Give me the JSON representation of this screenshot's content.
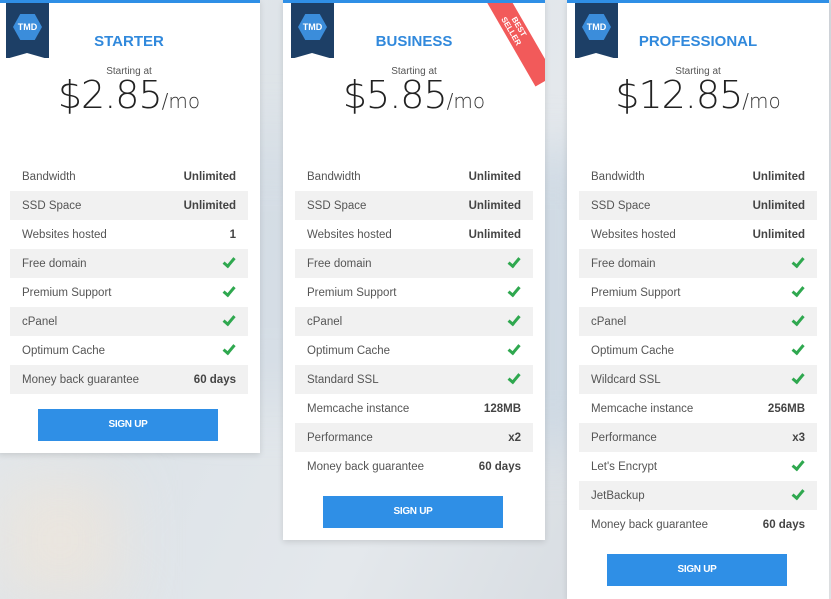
{
  "logo_text": "TMD",
  "starting_label": "Starting at",
  "per_label": "/mo",
  "signup_label": "SIGN UP",
  "best_seller": [
    "BEST",
    "SELLER"
  ],
  "colors": {
    "accent": "#2f8fe6",
    "ribbon": "#1d3f66",
    "badge": "#f25a5a",
    "check": "#2fa84f"
  },
  "plans": [
    {
      "name": "STARTER",
      "price": "$2.85",
      "features": [
        {
          "label": "Bandwidth",
          "value": "Unlimited"
        },
        {
          "label": "SSD Space",
          "value": "Unlimited"
        },
        {
          "label": "Websites hosted",
          "value": "1"
        },
        {
          "label": "Free domain",
          "value": "check"
        },
        {
          "label": "Premium Support",
          "value": "check"
        },
        {
          "label": "cPanel",
          "value": "check"
        },
        {
          "label": "Optimum Cache",
          "value": "check"
        },
        {
          "label": "Money back guarantee",
          "value": "60 days"
        }
      ]
    },
    {
      "name": "BUSINESS",
      "price": "$5.85",
      "features": [
        {
          "label": "Bandwidth",
          "value": "Unlimited"
        },
        {
          "label": "SSD Space",
          "value": "Unlimited"
        },
        {
          "label": "Websites hosted",
          "value": "Unlimited"
        },
        {
          "label": "Free domain",
          "value": "check"
        },
        {
          "label": "Premium Support",
          "value": "check"
        },
        {
          "label": "cPanel",
          "value": "check"
        },
        {
          "label": "Optimum Cache",
          "value": "check"
        },
        {
          "label": "Standard SSL",
          "value": "check"
        },
        {
          "label": "Memcache instance",
          "value": "128MB"
        },
        {
          "label": "Performance",
          "value": "x2"
        },
        {
          "label": "Money back guarantee",
          "value": "60 days"
        }
      ]
    },
    {
      "name": "PROFESSIONAL",
      "price": "$12.85",
      "features": [
        {
          "label": "Bandwidth",
          "value": "Unlimited"
        },
        {
          "label": "SSD Space",
          "value": "Unlimited"
        },
        {
          "label": "Websites hosted",
          "value": "Unlimited"
        },
        {
          "label": "Free domain",
          "value": "check"
        },
        {
          "label": "Premium Support",
          "value": "check"
        },
        {
          "label": "cPanel",
          "value": "check"
        },
        {
          "label": "Optimum Cache",
          "value": "check"
        },
        {
          "label": "Wildcard SSL",
          "value": "check"
        },
        {
          "label": "Memcache instance",
          "value": "256MB"
        },
        {
          "label": "Performance",
          "value": "x3"
        },
        {
          "label": "Let's Encrypt",
          "value": "check"
        },
        {
          "label": "JetBackup",
          "value": "check"
        },
        {
          "label": "Money back guarantee",
          "value": "60 days"
        }
      ]
    }
  ]
}
